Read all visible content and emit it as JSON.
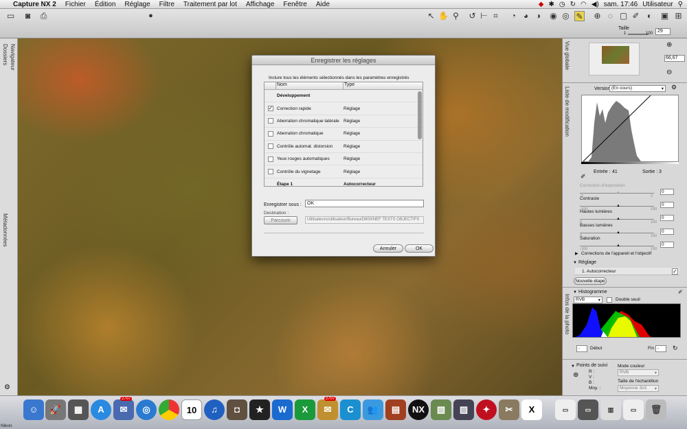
{
  "menubar": {
    "apple": "",
    "app": "Capture NX 2",
    "items": [
      "Fichier",
      "Édition",
      "Réglage",
      "Filtre",
      "Traitement par lot",
      "Affichage",
      "Fenêtre",
      "Aide"
    ],
    "clock": "sam. 17:46",
    "user": "Utilisateur"
  },
  "toolbar": {
    "size_label": "Taille",
    "size_min": "1",
    "size_max": "100",
    "size_value": "29"
  },
  "left_panels": {
    "folders": "Dossiers",
    "navigator": "Navigateur",
    "metadata": "Métadonnées"
  },
  "dialog": {
    "title": "Enregistrer les réglages",
    "instruction": "Inclure tous les éléments sélectionnés dans les paramètres enregistrés",
    "col_name": "Nom",
    "col_type": "Type",
    "rows": [
      {
        "name": "Développement",
        "type": "",
        "bold": true,
        "checked": false,
        "checkbox": false
      },
      {
        "name": "Correction rapide",
        "type": "Réglage",
        "bold": false,
        "checked": true,
        "checkbox": true
      },
      {
        "name": "Aberration chromatique latérale",
        "type": "Réglage",
        "bold": false,
        "checked": false,
        "checkbox": true
      },
      {
        "name": "Aberration chromatique",
        "type": "Réglage",
        "bold": false,
        "checked": false,
        "checkbox": true
      },
      {
        "name": "Contrôle automat. distorsion",
        "type": "Réglage",
        "bold": false,
        "checked": false,
        "checkbox": true
      },
      {
        "name": "Yeux rouges automatiques",
        "type": "Réglage",
        "bold": false,
        "checked": false,
        "checkbox": true
      },
      {
        "name": "Contrôle du vignetage",
        "type": "Réglage",
        "bold": false,
        "checked": false,
        "checkbox": true
      },
      {
        "name": "Étape 1",
        "type": "Autocorrecteur",
        "bold": true,
        "checked": false,
        "checkbox": false
      }
    ],
    "save_as_label": "Enregistrer sous :",
    "save_as_value": "OK",
    "destination_label": "Destination :",
    "browse_label": "Parcourir",
    "destination_path": "Utilisateurs/utilisateur/Bureau/D800/NEF TESTS OBJECTIFS",
    "cancel_label": "Annuler",
    "ok_label": "OK"
  },
  "right": {
    "overview_label": "Vue globale",
    "zoom": "66,67",
    "edit_list_label": "Liste de modification",
    "version_label": "Version",
    "version_value": "(En cours)",
    "input_label": "Entrée :",
    "input_value": "41",
    "output_label": "Sortie :",
    "output_value": "3",
    "sliders": [
      {
        "label": "Correction d'exposition",
        "min": "-2",
        "max": "2",
        "value": "0",
        "disabled": true
      },
      {
        "label": "Contraste",
        "min": "-100",
        "max": "100",
        "value": "0",
        "disabled": false
      },
      {
        "label": "Hautes lumières",
        "min": "0",
        "max": "100",
        "value": "0",
        "disabled": false
      },
      {
        "label": "Basses lumières",
        "min": "0",
        "max": "100",
        "value": "0",
        "disabled": false
      },
      {
        "label": "Saturation",
        "min": "-100",
        "max": "100",
        "value": "0",
        "disabled": false
      }
    ],
    "camera_corrections": "Corrections de l'appareil et l'objectif",
    "adjust_label": "Réglage",
    "auto_item": "1. Autocorrecteur",
    "new_step": "Nouvelle étape",
    "photo_info_label": "Infos de la photo",
    "histogram_label": "Histogramme",
    "channel": "RVB",
    "double_threshold": "Double seuil",
    "start_label": "Début",
    "start_value": "-",
    "end_label": "Fin",
    "end_value": "-",
    "tracking_label": "Points de suivi",
    "color_mode_label": "Mode couleur",
    "color_mode_value": "RVB",
    "r_label": "R :",
    "g_label": "V :",
    "b_label": "B :",
    "avg_label": "Moy. :",
    "sample_size_label": "Taille de l'échantillon",
    "sample_size_value": "Moyenne 3x3"
  },
  "dock": {
    "nikon_label": "Nikon",
    "calendar_day": "10",
    "badge1": "2707",
    "badge2": "2707"
  },
  "colors": {
    "accent": "#3875d7",
    "dialog_bg": "#ececec"
  }
}
